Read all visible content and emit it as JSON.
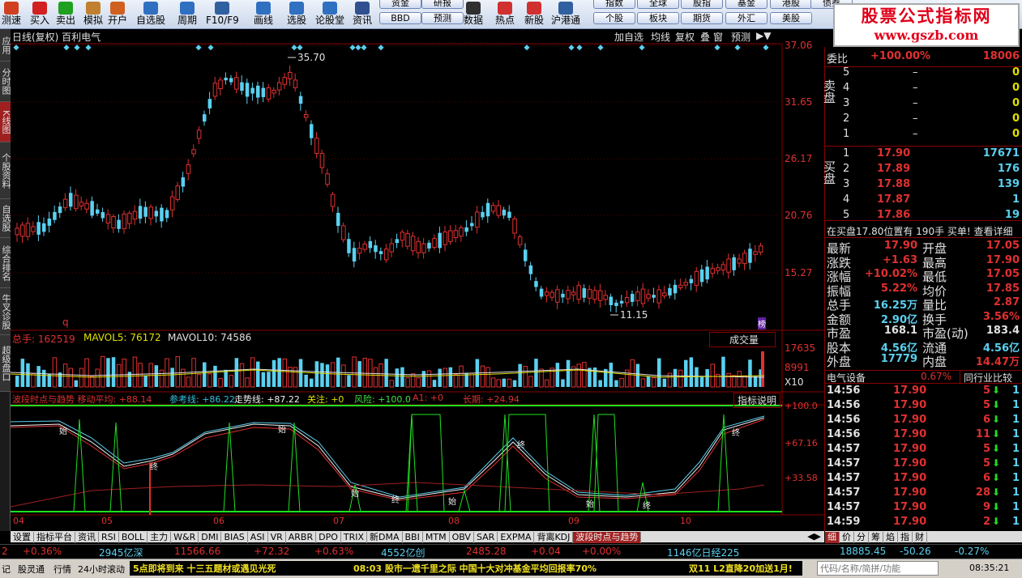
{
  "toolbar": {
    "buttons": [
      {
        "label": "测速",
        "icon": "speedometer-icon"
      },
      {
        "label": "买入",
        "icon": "buy-icon"
      },
      {
        "label": "卖出",
        "icon": "sell-icon"
      },
      {
        "label": "模拟",
        "icon": "hammer-icon"
      },
      {
        "label": "开户",
        "icon": "account-icon"
      },
      {
        "label": "自选股",
        "icon": "plus-icon"
      },
      {
        "label": "周期",
        "icon": "calendar-icon"
      },
      {
        "label": "F10/F9",
        "icon": "f10-icon"
      },
      {
        "label": "画线",
        "icon": "pencil-icon"
      },
      {
        "label": "选股",
        "icon": "filter-icon"
      },
      {
        "label": "论股堂",
        "icon": "chat-icon"
      },
      {
        "label": "资讯",
        "icon": "news-icon"
      },
      {
        "label": "数据",
        "icon": "pe-icon"
      },
      {
        "label": "热点",
        "icon": "hot-icon"
      },
      {
        "label": "新股",
        "icon": "new-icon"
      },
      {
        "label": "沪港通",
        "icon": "hk-icon"
      }
    ],
    "pills": [
      "资金",
      "研报",
      "BBD",
      "预测",
      "指数",
      "全球",
      "个股",
      "板块",
      "股指",
      "期货",
      "基金",
      "外汇",
      "港股",
      "美股",
      "债券"
    ]
  },
  "brand": {
    "line1": "股票公式指标网",
    "line2": "www.gszb.com"
  },
  "left_tabs": [
    "应用",
    "分时图",
    "K线图",
    "个股资料",
    "自选股",
    "综合排名",
    "牛叉诊股",
    "超级盘口"
  ],
  "chart": {
    "title": "日线(复权) 百利电气",
    "top_buttons": [
      "加自选",
      "均线",
      "复权",
      "叠",
      "窗",
      "预测"
    ],
    "price_axis": [
      "37.06",
      "31.65",
      "26.17",
      "20.76",
      "15.27"
    ],
    "high_label": "35.70",
    "low_label": "11.15",
    "q_label": "q",
    "bang_label": "榜",
    "vol_line": {
      "total": "总手: 162519",
      "ma5": "MAVOL5: 76172",
      "ma10": "MAVOL10: 74586"
    },
    "vol_axis": [
      "17635",
      "8991",
      "X10"
    ],
    "vol_select": "成交量",
    "ind_line": [
      {
        "t": "波段时点与趋势 移动平均: +88.14",
        "c": "#e03030"
      },
      {
        "t": "参考线: +86.22",
        "c": "#30c0e0"
      },
      {
        "t": "走势线: +87.22",
        "c": "#f0f0f0"
      },
      {
        "t": "关注: +0",
        "c": "#e0e000"
      },
      {
        "t": "风险: +100.0",
        "c": "#40e040"
      },
      {
        "t": "A1: +0",
        "c": "#e03030"
      },
      {
        "t": "长期: +24.94",
        "c": "#e03030"
      }
    ],
    "ind_help": "指标说明",
    "ind_axis": [
      "+100.0",
      "+67.16",
      "+33.58"
    ],
    "x_axis": [
      "04",
      "05",
      "06",
      "07",
      "08",
      "09",
      "10"
    ],
    "ind_marks": [
      "始",
      "终",
      "始",
      "终",
      "始",
      "终",
      "始",
      "终",
      "终",
      "始"
    ]
  },
  "panel": {
    "weibi_label": "委比",
    "weibi_pct": "+100.00%",
    "weibi_val": "18006",
    "sell_label": "卖盘",
    "buy_label": "买盘",
    "sell": [
      {
        "n": "5",
        "p": "–",
        "v": "0"
      },
      {
        "n": "4",
        "p": "–",
        "v": "0"
      },
      {
        "n": "3",
        "p": "–",
        "v": "0"
      },
      {
        "n": "2",
        "p": "–",
        "v": "0"
      },
      {
        "n": "1",
        "p": "–",
        "v": "0"
      }
    ],
    "buy": [
      {
        "n": "1",
        "p": "17.90",
        "v": "17671"
      },
      {
        "n": "2",
        "p": "17.89",
        "v": "176"
      },
      {
        "n": "3",
        "p": "17.88",
        "v": "139"
      },
      {
        "n": "4",
        "p": "17.87",
        "v": "1"
      },
      {
        "n": "5",
        "p": "17.86",
        "v": "19"
      }
    ],
    "info_bar": "在买盘17.80位置有 190手 买单! 查看详细",
    "quotes": [
      [
        "最新",
        "17.90",
        "开盘",
        "17.05"
      ],
      [
        "涨跌",
        "+1.63",
        "最高",
        "17.90"
      ],
      [
        "涨幅",
        "+10.02%",
        "最低",
        "17.05"
      ],
      [
        "振幅",
        "5.22%",
        "均价",
        "17.85"
      ],
      [
        "总手",
        "16.25万",
        "量比",
        "2.87"
      ],
      [
        "金额",
        "2.90亿",
        "换手",
        "3.56%"
      ],
      [
        "市盈",
        "168.1",
        "市盈(动)",
        "183.4"
      ],
      [
        "股本",
        "4.56亿",
        "流通",
        "4.56亿"
      ],
      [
        "外盘",
        "17779",
        "内盘",
        "14.47万"
      ]
    ],
    "sector": "电气设备",
    "sector_pct": "0.67%",
    "sector_btn": "同行业比较",
    "ticks": [
      [
        "14:56",
        "17.90",
        "5",
        "1"
      ],
      [
        "14:56",
        "17.90",
        "5",
        "1"
      ],
      [
        "14:56",
        "17.90",
        "6",
        "1"
      ],
      [
        "14:56",
        "17.90",
        "11",
        "1"
      ],
      [
        "14:57",
        "17.90",
        "5",
        "1"
      ],
      [
        "14:57",
        "17.90",
        "5",
        "1"
      ],
      [
        "14:57",
        "17.90",
        "6",
        "1"
      ],
      [
        "14:57",
        "17.90",
        "28",
        "1"
      ],
      [
        "14:57",
        "17.90",
        "9",
        "1"
      ],
      [
        "14:59",
        "17.90",
        "2",
        "1"
      ]
    ],
    "bottom_tabs": [
      "细",
      "价",
      "分",
      "筹",
      "焰",
      "指",
      "财"
    ]
  },
  "bottom_tabs": [
    "设置",
    "指标平台",
    "资讯",
    "RSI",
    "BOLL",
    "主力",
    "W&R",
    "DMI",
    "BIAS",
    "ASI",
    "VR",
    "ARBR",
    "DPO",
    "TRIX",
    "新DMA",
    "BBI",
    "MTM",
    "OBV",
    "SAR",
    "EXPMA",
    "背离KDJ",
    "波段时点与趋势"
  ],
  "index_bar": {
    "a": "2",
    "b": "+0.36%",
    "c": "2945亿深",
    "d": "11566.66",
    "e": "+72.32",
    "f": "+0.63%",
    "g": "4552亿创",
    "h": "2485.28",
    "i": "+0.04",
    "j": "+0.00%",
    "k": "1146亿日经225",
    "l": "18885.45",
    "m": "-50.26",
    "n": "-0.27%"
  },
  "status": {
    "s1": "记",
    "s2": "股灵通",
    "s3": "行情",
    "s4": "24小时滚动",
    "news1": "5点即将到来 十三五题材或遇见光死",
    "news2": "08:03 股市一遗千里之际 中国十大对冲基金平均回报率70%",
    "news3": "双11 L2直降20加送1月!",
    "search": "代码/名称/简拼/功能",
    "time": "08:35:21"
  }
}
